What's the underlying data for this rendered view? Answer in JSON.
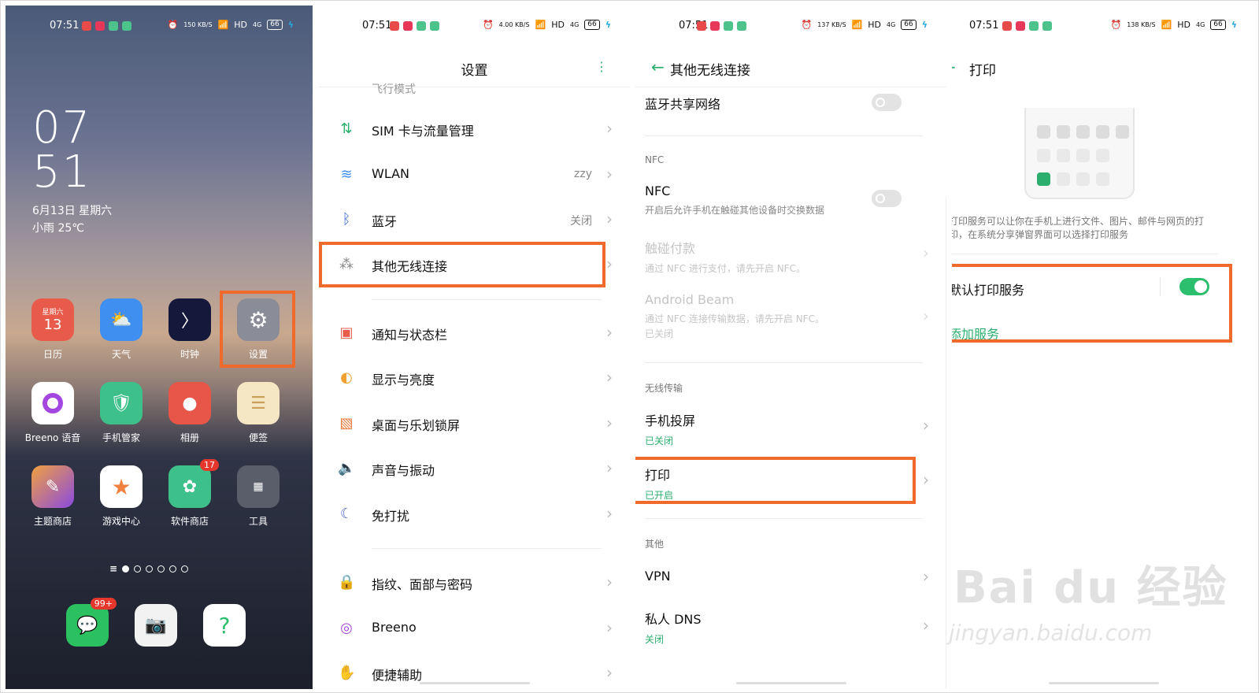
{
  "status": {
    "time": "07:51",
    "net_speeds": [
      "150 KB/S",
      "4.00 KB/S",
      "137 KB/S",
      "138 KB/S"
    ],
    "hd": "HD",
    "signal": "4G",
    "battery": "66"
  },
  "home": {
    "clock_hour": "07",
    "clock_minute": "51",
    "date": "6月13日 星期六",
    "weather": "小雨 25℃",
    "calendar_weekday": "星期六",
    "calendar_day": "13",
    "apps": [
      {
        "label": "日历"
      },
      {
        "label": "天气"
      },
      {
        "label": "时钟"
      },
      {
        "label": "设置"
      },
      {
        "label": "Breeno 语音"
      },
      {
        "label": "手机管家"
      },
      {
        "label": "相册"
      },
      {
        "label": "便签"
      },
      {
        "label": "主题商店"
      },
      {
        "label": "游戏中心"
      },
      {
        "label": "软件商店",
        "badge": "17"
      },
      {
        "label": "工具"
      }
    ],
    "dock_badge": "99+"
  },
  "settings": {
    "title": "设置",
    "partial_top": "飞行模式",
    "items": [
      {
        "label": "SIM 卡与流量管理",
        "value": ""
      },
      {
        "label": "WLAN",
        "value": "zzy"
      },
      {
        "label": "蓝牙",
        "value": "关闭"
      },
      {
        "label": "其他无线连接",
        "value": ""
      },
      {
        "label": "通知与状态栏",
        "value": ""
      },
      {
        "label": "显示与亮度",
        "value": ""
      },
      {
        "label": "桌面与乐划锁屏",
        "value": ""
      },
      {
        "label": "声音与振动",
        "value": ""
      },
      {
        "label": "免打扰",
        "value": ""
      },
      {
        "label": "指纹、面部与密码",
        "value": ""
      },
      {
        "label": "Breeno",
        "value": ""
      },
      {
        "label": "便捷辅助",
        "value": ""
      }
    ]
  },
  "wireless": {
    "title": "其他无线连接",
    "bt_tether": "蓝牙共享网络",
    "cat_nfc": "NFC",
    "nfc": {
      "label": "NFC",
      "sub": "开启后允许手机在触碰其他设备时交换数据"
    },
    "tap_pay": {
      "label": "触碰付款",
      "sub": "通过 NFC 进行支付，请先开启 NFC。"
    },
    "beam": {
      "label": "Android Beam",
      "sub": "通过 NFC 连接传输数据，请先开启 NFC。",
      "sub2": "已关闭"
    },
    "cat_wireless": "无线传输",
    "cast": {
      "label": "手机投屏",
      "sub": "已关闭"
    },
    "print": {
      "label": "打印",
      "sub": "已开启"
    },
    "cat_other": "其他",
    "vpn": {
      "label": "VPN"
    },
    "dns": {
      "label": "私人 DNS",
      "sub": "关闭"
    }
  },
  "print_page": {
    "title": "打印",
    "desc": "打印服务可以让你在手机上进行文件、图片、邮件与网页的打印，在系统分享弹窗界面可以选择打印服务",
    "default_service": "默认打印服务",
    "add_service": "添加服务"
  },
  "watermark": {
    "brand": "Bai du 经验",
    "url": "jingyan.baidu.com"
  },
  "colors": {
    "accent": "#2cae6e",
    "highlight": "#f06b2b"
  }
}
